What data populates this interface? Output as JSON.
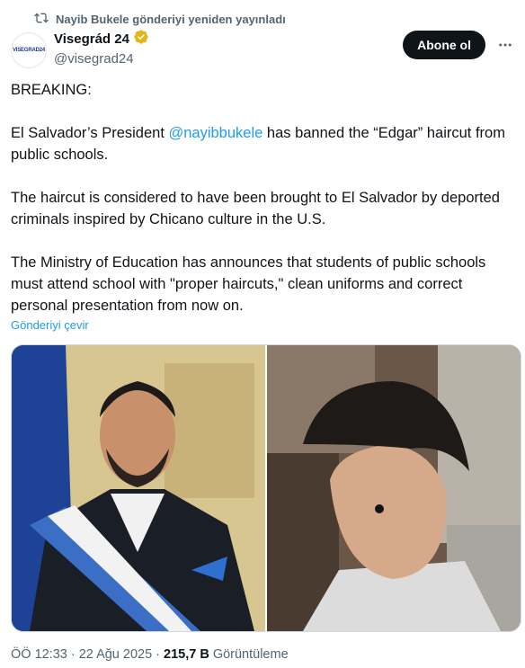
{
  "repost": {
    "text": "Nayib Bukele gönderiyi yeniden yayınladı",
    "icon": "repost-icon"
  },
  "author": {
    "display_name": "Visegrád 24",
    "handle": "@visegrad24",
    "avatar_text": "VISEGRAD24",
    "verified_color": "#e2b719"
  },
  "actions": {
    "follow_label": "Abone ol",
    "more_icon": "more-icon"
  },
  "post": {
    "p1": "BREAKING:",
    "p2_before": "El Salvador’s President ",
    "p2_mention": "@nayibbukele",
    "p2_after": " has banned the “Edgar” haircut from public schools.",
    "p3": "The haircut is considered to have been brought to El Salvador by deported criminals inspired by Chicano culture in the U.S.",
    "p4": "The Ministry of Education has announces that students of public schools must  attend school with \"proper haircuts,\" clean uniforms and correct personal presentation from now on."
  },
  "translate_label": "Gönderiyi çevir",
  "media": {
    "images": [
      {
        "name": "president-photo"
      },
      {
        "name": "haircut-photo"
      }
    ]
  },
  "meta": {
    "time": "ÖÖ 12:33",
    "sep1": "·",
    "date": "22 Ağu 2025",
    "sep2": "·",
    "views_count": "215,7 B",
    "views_label": "Görüntüleme"
  },
  "colors": {
    "link": "#1d9bf0",
    "secondary": "#536471",
    "primary": "#0f1419"
  }
}
